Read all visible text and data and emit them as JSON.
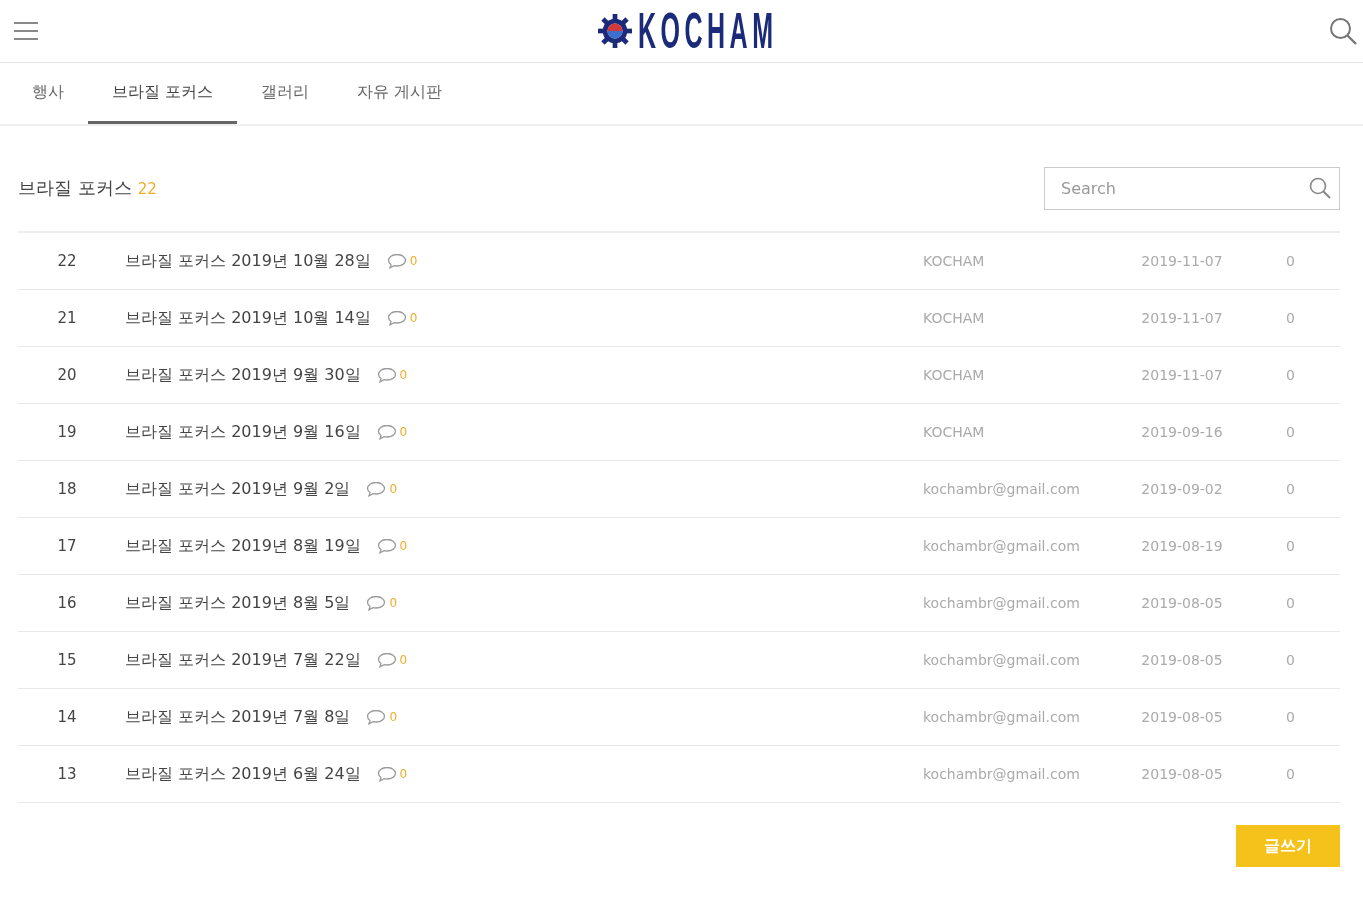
{
  "header": {
    "logo_text": "KOCHAM"
  },
  "tabs": [
    {
      "label": "행사",
      "selected": false
    },
    {
      "label": "브라질 포커스",
      "selected": true
    },
    {
      "label": "갤러리",
      "selected": false
    },
    {
      "label": "자유 게시판",
      "selected": false
    }
  ],
  "board": {
    "title": "브라질 포커스",
    "count": "22"
  },
  "search": {
    "placeholder": "Search"
  },
  "posts": [
    {
      "number": "22",
      "title": "브라질 포커스 2019년 10월 28일",
      "comments": "0",
      "author": "KOCHAM",
      "date": "2019-11-07",
      "views": "0"
    },
    {
      "number": "21",
      "title": "브라질 포커스 2019년 10월 14일",
      "comments": "0",
      "author": "KOCHAM",
      "date": "2019-11-07",
      "views": "0"
    },
    {
      "number": "20",
      "title": "브라질 포커스 2019년 9월 30일",
      "comments": "0",
      "author": "KOCHAM",
      "date": "2019-11-07",
      "views": "0"
    },
    {
      "number": "19",
      "title": "브라질 포커스 2019년 9월 16일",
      "comments": "0",
      "author": "KOCHAM",
      "date": "2019-09-16",
      "views": "0"
    },
    {
      "number": "18",
      "title": "브라질 포커스 2019년 9월 2일",
      "comments": "0",
      "author": "kochambr@gmail.com",
      "date": "2019-09-02",
      "views": "0"
    },
    {
      "number": "17",
      "title": "브라질 포커스 2019년 8월 19일",
      "comments": "0",
      "author": "kochambr@gmail.com",
      "date": "2019-08-19",
      "views": "0"
    },
    {
      "number": "16",
      "title": "브라질 포커스 2019년 8월 5일",
      "comments": "0",
      "author": "kochambr@gmail.com",
      "date": "2019-08-05",
      "views": "0"
    },
    {
      "number": "15",
      "title": "브라질 포커스 2019년 7월 22일",
      "comments": "0",
      "author": "kochambr@gmail.com",
      "date": "2019-08-05",
      "views": "0"
    },
    {
      "number": "14",
      "title": "브라질 포커스 2019년 7월 8일",
      "comments": "0",
      "author": "kochambr@gmail.com",
      "date": "2019-08-05",
      "views": "0"
    },
    {
      "number": "13",
      "title": "브라질 포커스 2019년 6월 24일",
      "comments": "0",
      "author": "kochambr@gmail.com",
      "date": "2019-08-05",
      "views": "0"
    }
  ],
  "write_button": "글쓰기"
}
